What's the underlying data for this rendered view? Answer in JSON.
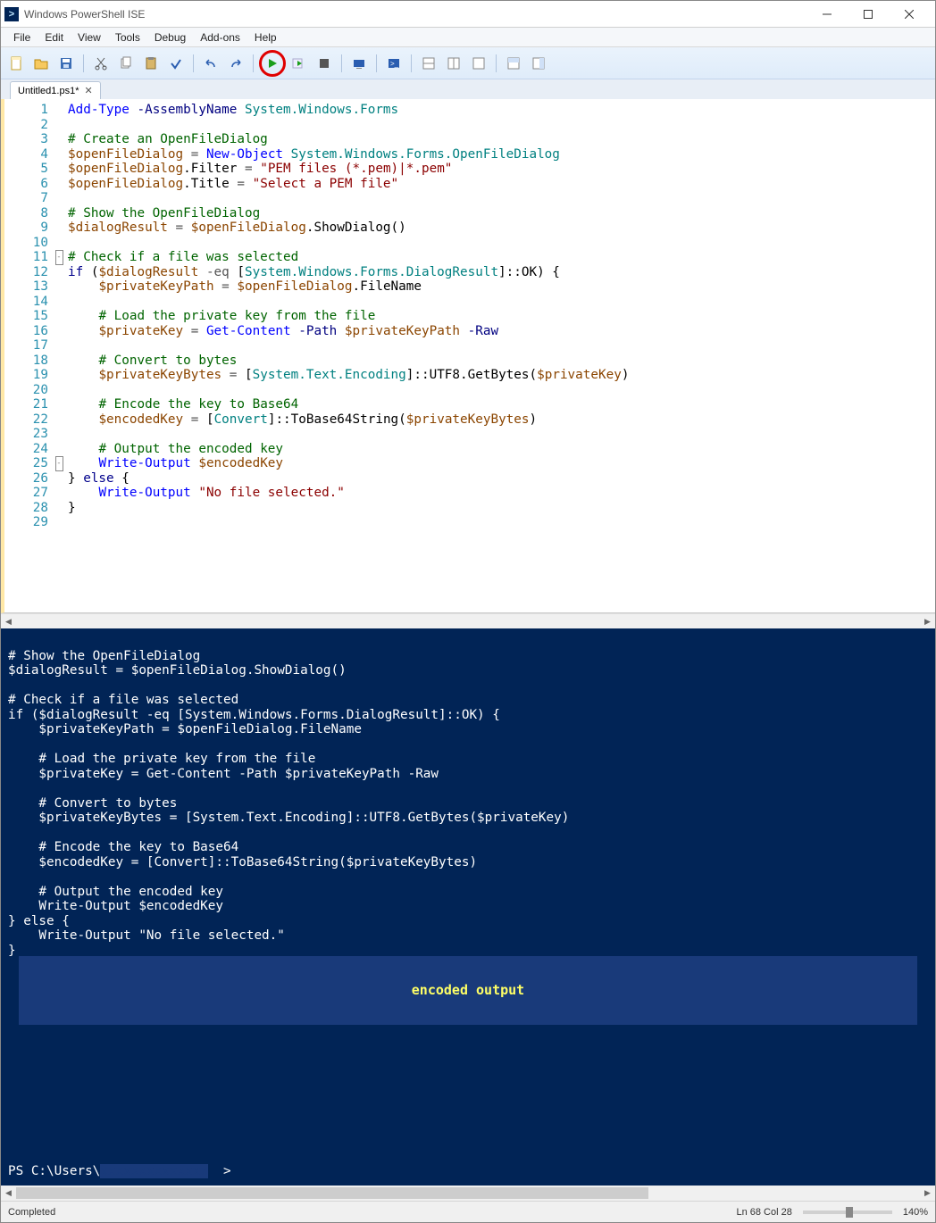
{
  "window": {
    "title": "Windows PowerShell ISE"
  },
  "menus": [
    "File",
    "Edit",
    "View",
    "Tools",
    "Debug",
    "Add-ons",
    "Help"
  ],
  "tab": {
    "label": "Untitled1.ps1*"
  },
  "gutter_lines": [
    "1",
    "2",
    "3",
    "4",
    "5",
    "6",
    "7",
    "8",
    "9",
    "10",
    "11",
    "12",
    "13",
    "14",
    "15",
    "16",
    "17",
    "18",
    "19",
    "20",
    "21",
    "22",
    "23",
    "24",
    "25",
    "26",
    "27",
    "28",
    "29"
  ],
  "code_lines": [
    [
      {
        "t": "Add-Type",
        "c": "c-cmd"
      },
      {
        "t": " "
      },
      {
        "t": "-AssemblyName",
        "c": "c-param"
      },
      {
        "t": " "
      },
      {
        "t": "System.Windows.Forms",
        "c": "c-type"
      }
    ],
    [],
    [
      {
        "t": "# Create an OpenFileDialog",
        "c": "c-comment"
      }
    ],
    [
      {
        "t": "$openFileDialog",
        "c": "c-var"
      },
      {
        "t": " "
      },
      {
        "t": "=",
        "c": "c-op"
      },
      {
        "t": " "
      },
      {
        "t": "New-Object",
        "c": "c-cmd"
      },
      {
        "t": " "
      },
      {
        "t": "System.Windows.Forms.OpenFileDialog",
        "c": "c-type"
      }
    ],
    [
      {
        "t": "$openFileDialog",
        "c": "c-var"
      },
      {
        "t": "."
      },
      {
        "t": "Filter"
      },
      {
        "t": " "
      },
      {
        "t": "=",
        "c": "c-op"
      },
      {
        "t": " "
      },
      {
        "t": "\"PEM files (*.pem)|*.pem\"",
        "c": "c-str"
      }
    ],
    [
      {
        "t": "$openFileDialog",
        "c": "c-var"
      },
      {
        "t": "."
      },
      {
        "t": "Title"
      },
      {
        "t": " "
      },
      {
        "t": "=",
        "c": "c-op"
      },
      {
        "t": " "
      },
      {
        "t": "\"Select a PEM file\"",
        "c": "c-str"
      }
    ],
    [],
    [
      {
        "t": "# Show the OpenFileDialog",
        "c": "c-comment"
      }
    ],
    [
      {
        "t": "$dialogResult",
        "c": "c-var"
      },
      {
        "t": " "
      },
      {
        "t": "=",
        "c": "c-op"
      },
      {
        "t": " "
      },
      {
        "t": "$openFileDialog",
        "c": "c-var"
      },
      {
        "t": "."
      },
      {
        "t": "ShowDialog"
      },
      {
        "t": "()"
      }
    ],
    [],
    [
      {
        "t": "# Check if a file was selected",
        "c": "c-comment"
      }
    ],
    [
      {
        "t": "if",
        "c": "c-kw"
      },
      {
        "t": " ("
      },
      {
        "t": "$dialogResult",
        "c": "c-var"
      },
      {
        "t": " "
      },
      {
        "t": "-eq",
        "c": "c-op"
      },
      {
        "t": " ["
      },
      {
        "t": "System.Windows.Forms.DialogResult",
        "c": "c-type"
      },
      {
        "t": "]"
      },
      {
        "t": "::"
      },
      {
        "t": "OK"
      },
      {
        "t": ") {"
      }
    ],
    [
      {
        "t": "    "
      },
      {
        "t": "$privateKeyPath",
        "c": "c-var"
      },
      {
        "t": " "
      },
      {
        "t": "=",
        "c": "c-op"
      },
      {
        "t": " "
      },
      {
        "t": "$openFileDialog",
        "c": "c-var"
      },
      {
        "t": "."
      },
      {
        "t": "FileName"
      }
    ],
    [],
    [
      {
        "t": "    "
      },
      {
        "t": "# Load the private key from the file",
        "c": "c-comment"
      }
    ],
    [
      {
        "t": "    "
      },
      {
        "t": "$privateKey",
        "c": "c-var"
      },
      {
        "t": " "
      },
      {
        "t": "=",
        "c": "c-op"
      },
      {
        "t": " "
      },
      {
        "t": "Get-Content",
        "c": "c-cmd"
      },
      {
        "t": " "
      },
      {
        "t": "-Path",
        "c": "c-param"
      },
      {
        "t": " "
      },
      {
        "t": "$privateKeyPath",
        "c": "c-var"
      },
      {
        "t": " "
      },
      {
        "t": "-Raw",
        "c": "c-param"
      }
    ],
    [],
    [
      {
        "t": "    "
      },
      {
        "t": "# Convert to bytes",
        "c": "c-comment"
      }
    ],
    [
      {
        "t": "    "
      },
      {
        "t": "$privateKeyBytes",
        "c": "c-var"
      },
      {
        "t": " "
      },
      {
        "t": "=",
        "c": "c-op"
      },
      {
        "t": " ["
      },
      {
        "t": "System.Text.Encoding",
        "c": "c-type"
      },
      {
        "t": "]"
      },
      {
        "t": "::"
      },
      {
        "t": "UTF8"
      },
      {
        "t": "."
      },
      {
        "t": "GetBytes"
      },
      {
        "t": "("
      },
      {
        "t": "$privateKey",
        "c": "c-var"
      },
      {
        "t": ")"
      }
    ],
    [],
    [
      {
        "t": "    "
      },
      {
        "t": "# Encode the key to Base64",
        "c": "c-comment"
      }
    ],
    [
      {
        "t": "    "
      },
      {
        "t": "$encodedKey",
        "c": "c-var"
      },
      {
        "t": " "
      },
      {
        "t": "=",
        "c": "c-op"
      },
      {
        "t": " ["
      },
      {
        "t": "Convert",
        "c": "c-type"
      },
      {
        "t": "]"
      },
      {
        "t": "::"
      },
      {
        "t": "ToBase64String"
      },
      {
        "t": "("
      },
      {
        "t": "$privateKeyBytes",
        "c": "c-var"
      },
      {
        "t": ")"
      }
    ],
    [],
    [
      {
        "t": "    "
      },
      {
        "t": "# Output the encoded key",
        "c": "c-comment"
      }
    ],
    [
      {
        "t": "    "
      },
      {
        "t": "Write-Output",
        "c": "c-cmd"
      },
      {
        "t": " "
      },
      {
        "t": "$encodedKey",
        "c": "c-var"
      }
    ],
    [
      {
        "t": "}"
      },
      {
        "t": " "
      },
      {
        "t": "else",
        "c": "c-kw"
      },
      {
        "t": " {"
      }
    ],
    [
      {
        "t": "    "
      },
      {
        "t": "Write-Output",
        "c": "c-cmd"
      },
      {
        "t": " "
      },
      {
        "t": "\"No file selected.\"",
        "c": "c-str"
      }
    ],
    [
      {
        "t": "}"
      }
    ],
    []
  ],
  "fold_markers": {
    "11": "-",
    "25": "-"
  },
  "console_lines": [
    "# Show the OpenFileDialog",
    "$dialogResult = $openFileDialog.ShowDialog()",
    "",
    "# Check if a file was selected",
    "if ($dialogResult -eq [System.Windows.Forms.DialogResult]::OK) {",
    "    $privateKeyPath = $openFileDialog.FileName",
    "",
    "    # Load the private key from the file",
    "    $privateKey = Get-Content -Path $privateKeyPath -Raw",
    "",
    "    # Convert to bytes",
    "    $privateKeyBytes = [System.Text.Encoding]::UTF8.GetBytes($privateKey)",
    "",
    "    # Encode the key to Base64",
    "    $encodedKey = [Convert]::ToBase64String($privateKeyBytes)",
    "",
    "    # Output the encoded key",
    "    Write-Output $encodedKey",
    "} else {",
    "    Write-Output \"No file selected.\"",
    "}"
  ],
  "console_output_label": "encoded output",
  "console_prompt_prefix": "PS C:\\Users\\",
  "console_prompt_suffix": ">",
  "status": {
    "left": "Completed",
    "pos": "Ln 68  Col 28",
    "zoom": "140%"
  }
}
